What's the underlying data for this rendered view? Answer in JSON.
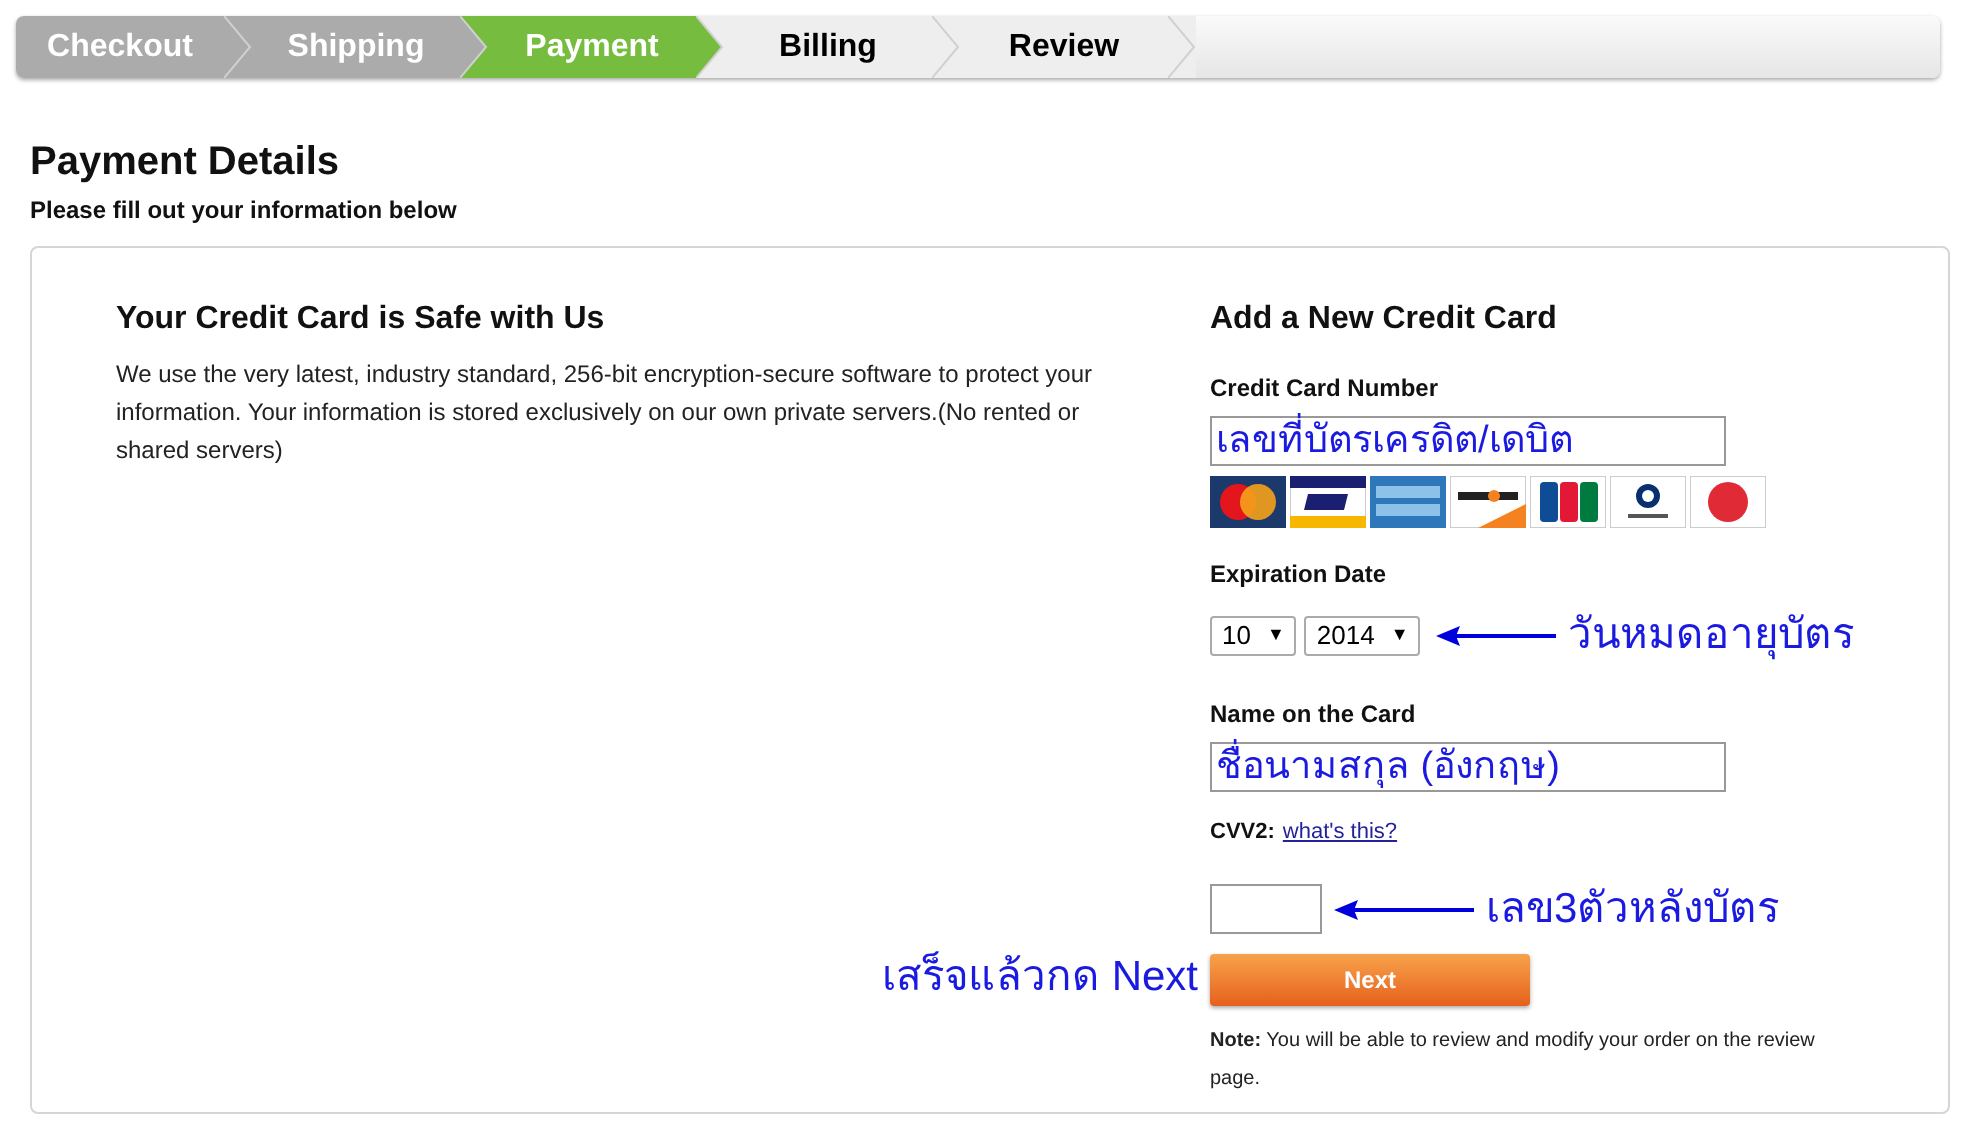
{
  "steps": [
    {
      "label": "Checkout",
      "kind": "done"
    },
    {
      "label": "Shipping",
      "kind": "done"
    },
    {
      "label": "Payment",
      "kind": "current"
    },
    {
      "label": "Billing",
      "kind": "todo"
    },
    {
      "label": "Review",
      "kind": "todo"
    }
  ],
  "page": {
    "title": "Payment Details",
    "subtitle": "Please fill out your information below"
  },
  "safety": {
    "title": "Your Credit Card is Safe with Us",
    "text": "We use the very latest, industry standard, 256-bit encryption-secure software to protect your information. Your information is stored exclusively on our own private servers.(No rented or shared servers)"
  },
  "form": {
    "title": "Add a New Credit Card",
    "card_number": {
      "label": "Credit Card Number",
      "value": "เลขที่บัตรเครดิต/เดบิต"
    },
    "cards": [
      {
        "kind": "mastercard"
      },
      {
        "kind": "visa"
      },
      {
        "kind": "amex"
      },
      {
        "kind": "discover"
      },
      {
        "kind": "jcb"
      },
      {
        "kind": "diners"
      },
      {
        "kind": "circle"
      }
    ],
    "expiration": {
      "label": "Expiration Date",
      "month": "10",
      "year": "2014",
      "caret": "▼",
      "note": "วันหมดอายุบัตร"
    },
    "name": {
      "label": "Name on the Card",
      "value": "ชื่อนามสกุล (อังกฤษ)"
    },
    "cvv": {
      "label": "CVV2:",
      "link": "what's this?",
      "note": "เลข3ตัวหลังบัตร"
    },
    "next": {
      "label": "Next",
      "note": "เสร็จแล้วกด Next"
    },
    "footnote": "**Note:** You will be able to review and modify your order on the review page."
  }
}
